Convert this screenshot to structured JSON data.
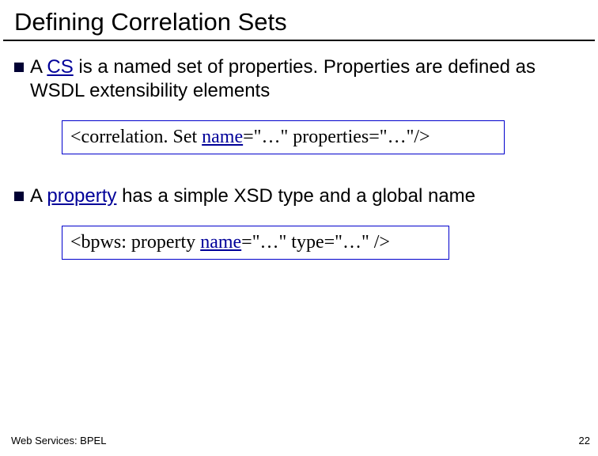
{
  "title": "Defining Correlation Sets",
  "bullets": [
    {
      "pre": "A ",
      "emph": "CS",
      "post": " is a named set of properties. Properties are defined as WSDL extensibility elements"
    },
    {
      "pre": "A ",
      "emph": "property",
      "post": " has a simple XSD type and a global name"
    }
  ],
  "code_boxes": [
    {
      "pre": "<correlation. Set ",
      "attr": "name",
      "mid": "=\"…\" properties=\"…\"/>"
    },
    {
      "pre": "<bpws: property ",
      "attr": "name",
      "mid": "=\"…\" type=\"…\" />"
    }
  ],
  "footer": {
    "left": "Web Services: BPEL",
    "right": "22"
  }
}
